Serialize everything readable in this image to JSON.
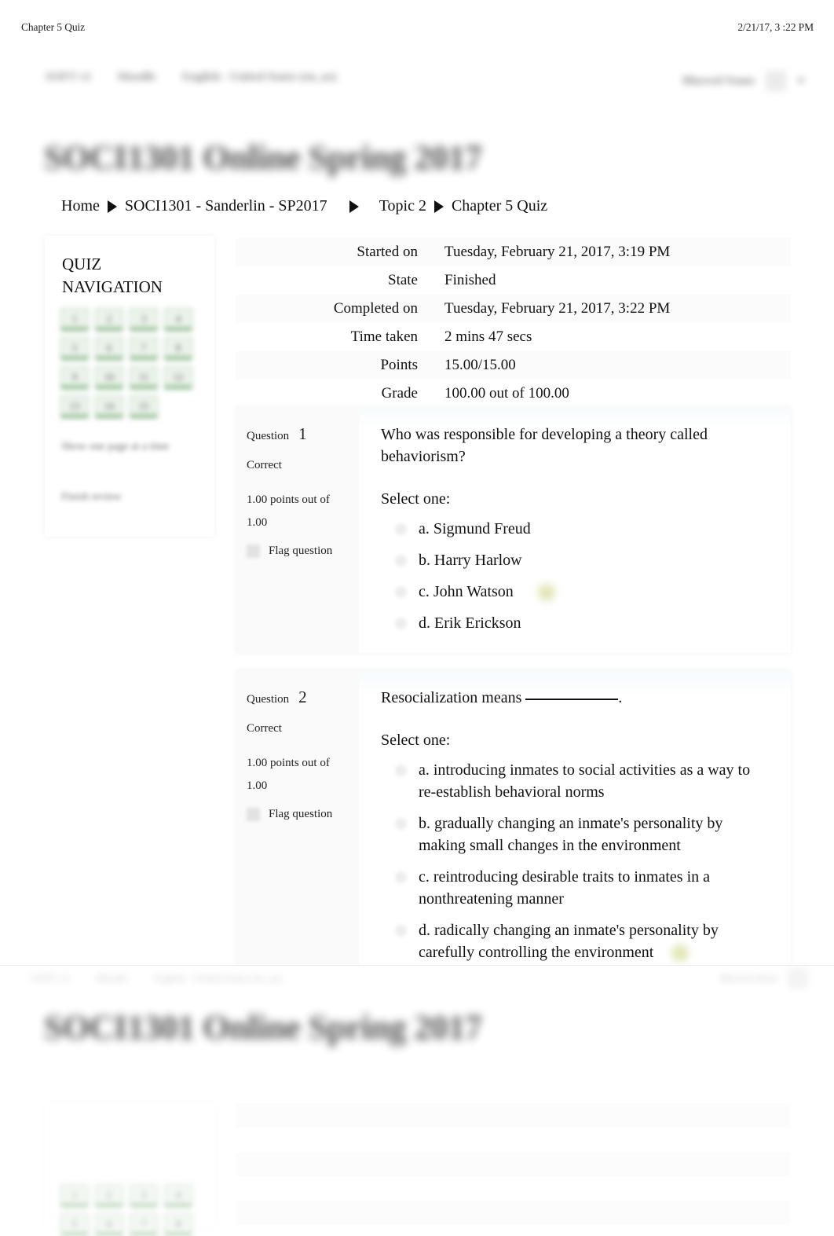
{
  "print_header": {
    "document_title": "Chapter 5 Quiz",
    "timestamp": "2/21/17, 3 :22 PM"
  },
  "navbar": {
    "items": [
      "SOFT v2",
      "Moodle",
      "English - United States (en_us)"
    ],
    "user_name": "Blurred Name",
    "avatar_icon": "avatar-icon",
    "caret_icon": "chevron-down-icon"
  },
  "course_title": "SOCI1301 Online Spring 2017",
  "breadcrumb": {
    "items": [
      "Home",
      "SOCI1301 - Sanderlin - SP2017",
      "Topic 2",
      "Chapter 5 Quiz"
    ],
    "separator_icon": "triangle-right-icon"
  },
  "quiz_navigation": {
    "title": "QUIZ NAVIGATION",
    "question_buttons": [
      "1",
      "2",
      "3",
      "4",
      "5",
      "6",
      "7",
      "8",
      "9",
      "10",
      "11",
      "12",
      "13",
      "14",
      "15"
    ],
    "show_one_page_label": "Show one page at a time",
    "finish_review_label": "Finish review"
  },
  "summary": {
    "rows": [
      {
        "label": "Started on",
        "value": "Tuesday, February 21, 2017, 3:19 PM"
      },
      {
        "label": "State",
        "value": "Finished"
      },
      {
        "label": "Completed on",
        "value": "Tuesday, February 21, 2017, 3:22 PM"
      },
      {
        "label": "Time taken",
        "value": "2 mins 47 secs"
      },
      {
        "label": "Points",
        "value": "15.00/15.00"
      },
      {
        "label": "Grade",
        "value": "100.00   out of 100.00"
      }
    ]
  },
  "questions": [
    {
      "label": "Question",
      "number": "1",
      "state": "Correct",
      "marks": "1.00 points out of 1.00",
      "flag_label": "Flag question",
      "flag_icon": "flag-icon",
      "text": "Who was responsible for developing a theory called behaviorism?",
      "select_label": "Select one:",
      "answers": [
        {
          "letter": "a.",
          "text": "Sigmund Freud",
          "correct": false
        },
        {
          "letter": "b.",
          "text": "Harry Harlow",
          "correct": false
        },
        {
          "letter": "c.",
          "text": "John Watson",
          "correct": true
        },
        {
          "letter": "d.",
          "text": "Erik Erickson",
          "correct": false
        }
      ]
    },
    {
      "label": "Question",
      "number": "2",
      "state": "Correct",
      "marks": "1.00 points out of 1.00",
      "flag_label": "Flag question",
      "flag_icon": "flag-icon",
      "text_prefix": "Resocialization means ",
      "text_suffix": ".",
      "select_label": "Select one:",
      "answers": [
        {
          "letter": "a.",
          "text": "introducing inmates to social activities as a way to re-establish behavioral norms",
          "correct": false
        },
        {
          "letter": "b.",
          "text": "gradually changing an inmate's personality by making small changes in the environment",
          "correct": false
        },
        {
          "letter": "c.",
          "text": "reintroducing desirable traits to inmates in a nonthreatening manner",
          "correct": false
        },
        {
          "letter": "d.",
          "text": "radically changing an inmate's personality by carefully controlling the environment",
          "correct": true
        }
      ]
    }
  ],
  "colors": {
    "correct_button": "#e7f1e7",
    "correct_button_border": "#5d9c5d",
    "correct_marker": "#cfd98b",
    "question_body_tint": "#f7fbfc"
  }
}
